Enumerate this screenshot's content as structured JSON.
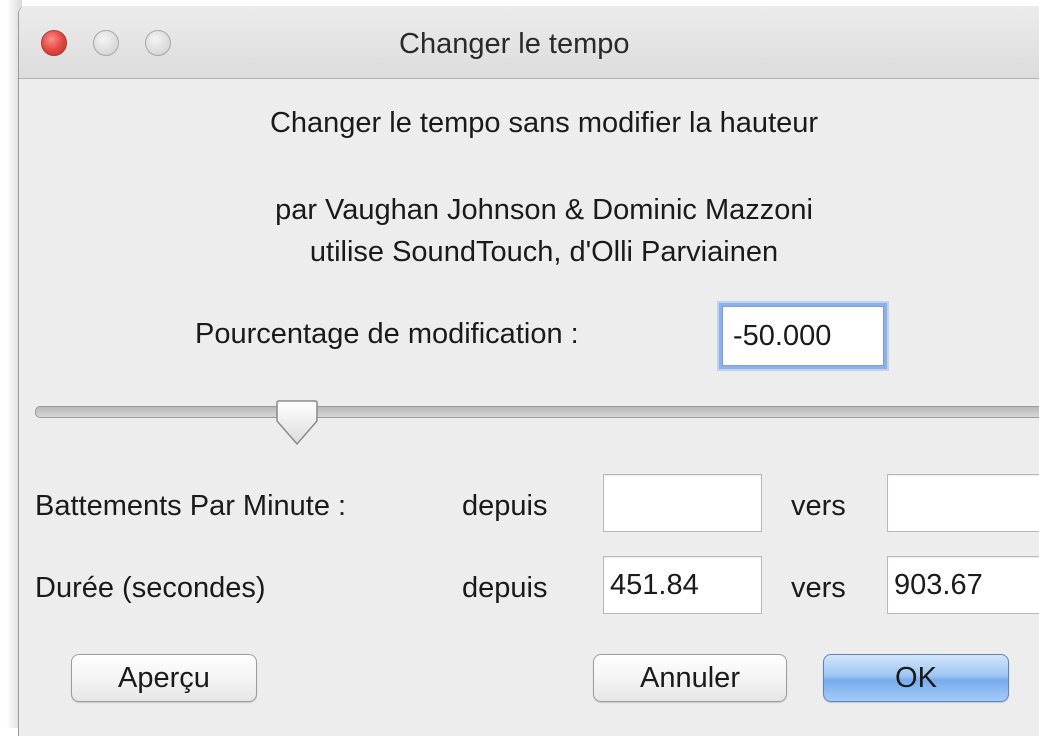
{
  "window": {
    "title": "Changer le tempo",
    "heading": "Changer le tempo sans modifier la hauteur",
    "credits_line1": "par Vaughan Johnson & Dominic Mazzoni",
    "credits_line2": "utilise SoundTouch, d'Olli Parviainen"
  },
  "percent": {
    "label": "Pourcentage de modification :",
    "value": "-50.000"
  },
  "slider": {
    "value_percent": -50
  },
  "bpm": {
    "label": "Battements Par Minute :",
    "from_label": "depuis",
    "from_value": "",
    "to_label": "vers",
    "to_value": ""
  },
  "duration": {
    "label": "Durée (secondes)",
    "from_label": "depuis",
    "from_value": "451.84",
    "to_label": "vers",
    "to_value": "903.67"
  },
  "buttons": {
    "preview": "Aperçu",
    "cancel": "Annuler",
    "ok": "OK"
  },
  "colors": {
    "window_bg": "#ededed",
    "close_button": "#e0443e",
    "focus_ring": "#8ab1ea",
    "default_button": "#77acef"
  },
  "icons": {
    "close": "close-icon",
    "minimize": "minimize-icon",
    "zoom": "zoom-icon"
  }
}
